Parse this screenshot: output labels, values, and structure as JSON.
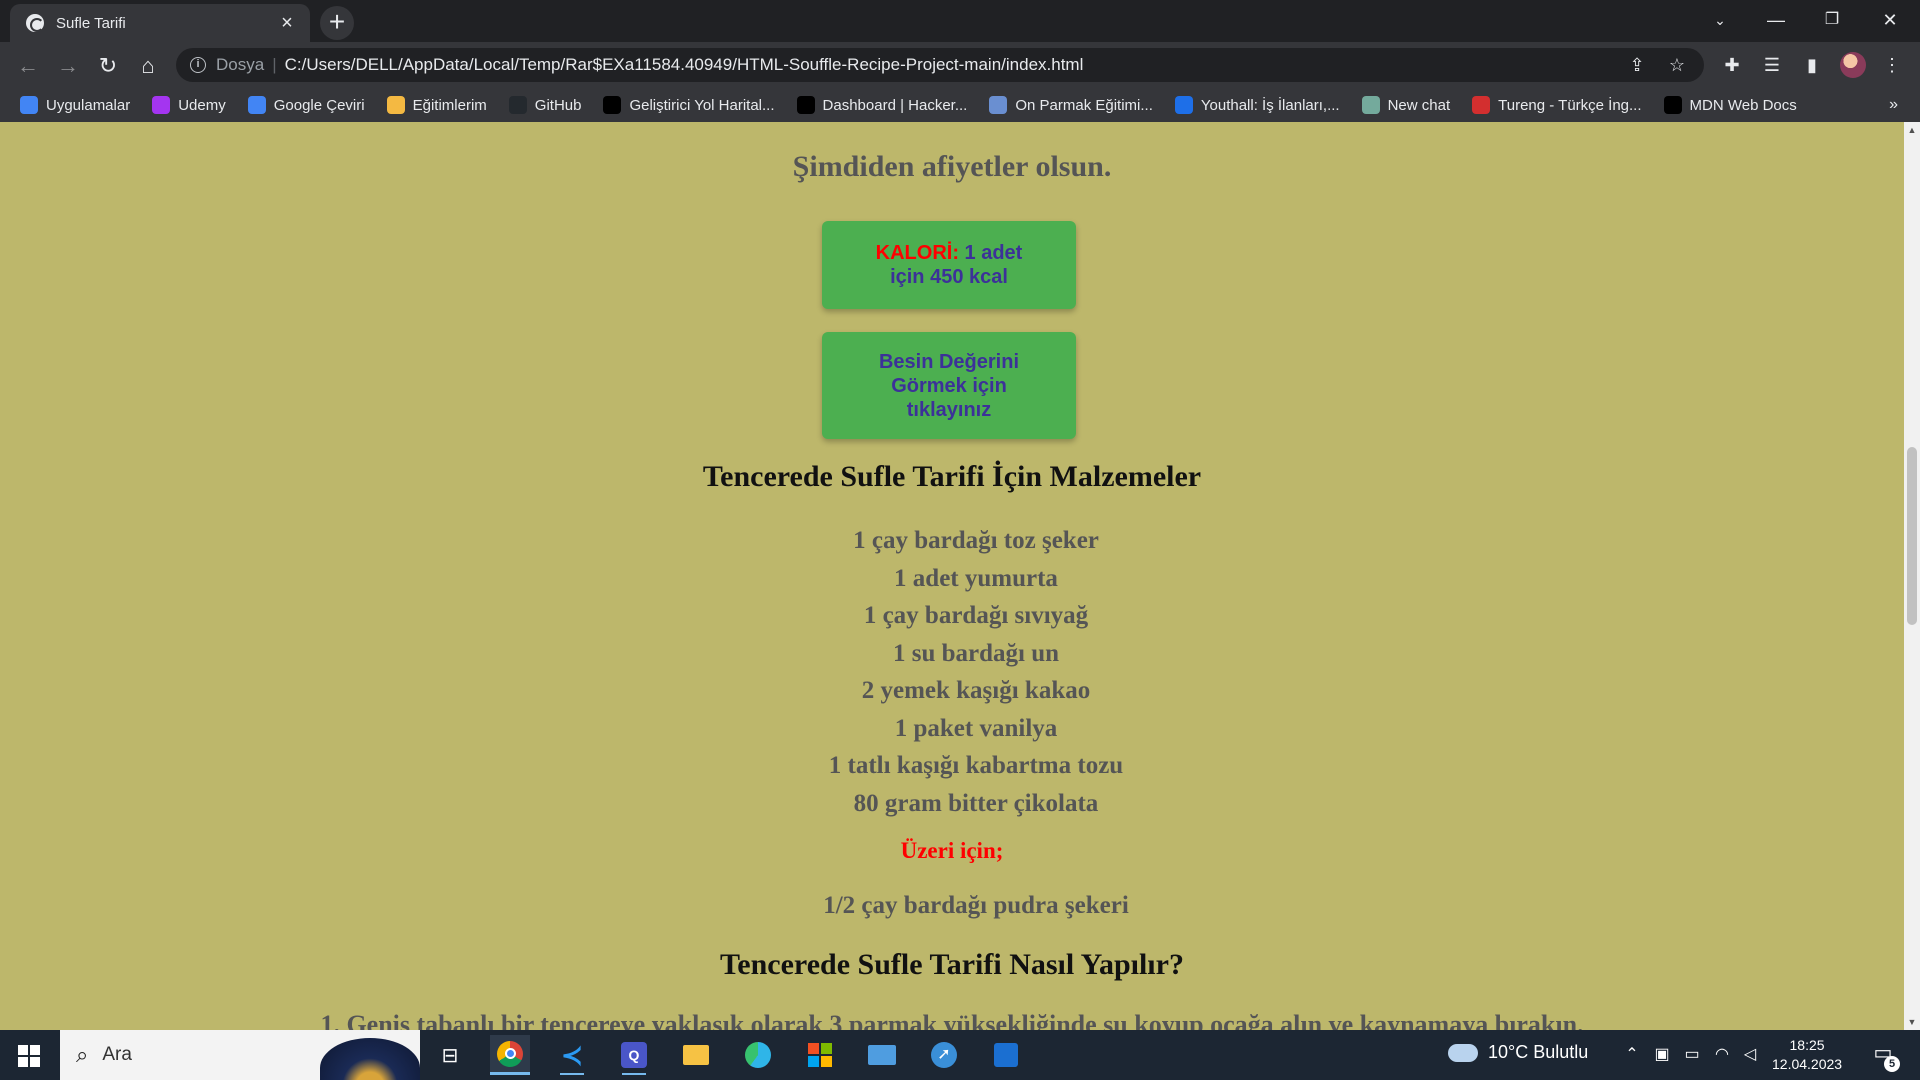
{
  "browser": {
    "tab_title": "Sufle Tarifi",
    "url_scheme": "Dosya",
    "url": "C:/Users/DELL/AppData/Local/Temp/Rar$EXa11584.40949/HTML-Souffle-Recipe-Project-main/index.html",
    "bookmarks": [
      {
        "label": "Uygulamalar",
        "icon": "apps-grid-icon",
        "color": "#4285f4"
      },
      {
        "label": "Udemy",
        "icon": "udemy-icon",
        "color": "#a435f0"
      },
      {
        "label": "Google Çeviri",
        "icon": "google-translate-icon",
        "color": "#4285f4"
      },
      {
        "label": "Eğitimlerim",
        "icon": "circle-icon",
        "color": "#f4b942"
      },
      {
        "label": "GitHub",
        "icon": "github-icon",
        "color": "#24292e"
      },
      {
        "label": "Geliştirici Yol Harital...",
        "icon": "roadmap-icon",
        "color": "#000000"
      },
      {
        "label": "Dashboard | Hacker...",
        "icon": "hackerrank-icon",
        "color": "#000000"
      },
      {
        "label": "On Parmak Eğitimi...",
        "icon": "drop-icon",
        "color": "#6a8fd1"
      },
      {
        "label": "Youthall: İş İlanları,...",
        "icon": "youthall-icon",
        "color": "#1e6fe8"
      },
      {
        "label": "New chat",
        "icon": "chatgpt-icon",
        "color": "#74aa9c"
      },
      {
        "label": "Tureng - Türkçe İng...",
        "icon": "tureng-icon",
        "color": "#d32f2f"
      },
      {
        "label": "MDN Web Docs",
        "icon": "mdn-icon",
        "color": "#000000"
      }
    ],
    "bookmarks_more": "»"
  },
  "page": {
    "closing": "Şimdiden afiyetler olsun.",
    "calorie_label": "KALORİ:",
    "calorie_value": " 1 adet için 450 kcal",
    "nutrition_button": "Besin Değerini Görmek için tıklayınız",
    "ingredients_title": "Tencerede Sufle Tarifi İçin Malzemeler",
    "ingredients": [
      "1 çay bardağı toz şeker",
      "1 adet yumurta",
      "1 çay bardağı sıvıyağ",
      "1 su bardağı un",
      "2 yemek kaşığı kakao",
      "1 paket vanilya",
      "1 tatlı kaşığı kabartma tozu",
      "80 gram bitter çikolata"
    ],
    "topping_label": "Üzeri için;",
    "topping_item": "1/2 çay bardağı pudra şekeri",
    "method_title": "Tencerede Sufle Tarifi Nasıl Yapılır?",
    "step_partial": "1. Geniş tabanlı bir tencereye yaklaşık olarak 3 parmak yüksekliğinde su koyup ocağa alın ve kaynamaya bırakın."
  },
  "taskbar": {
    "search_placeholder": "Ara",
    "weather": "10°C Bulutlu",
    "time": "18:25",
    "date": "12.04.2023",
    "notification_count": "5"
  },
  "colors": {
    "page_background": "#bdb76b",
    "button_green": "#4caf50",
    "button_text": "#3c3199",
    "accent_red": "#ff0000"
  }
}
